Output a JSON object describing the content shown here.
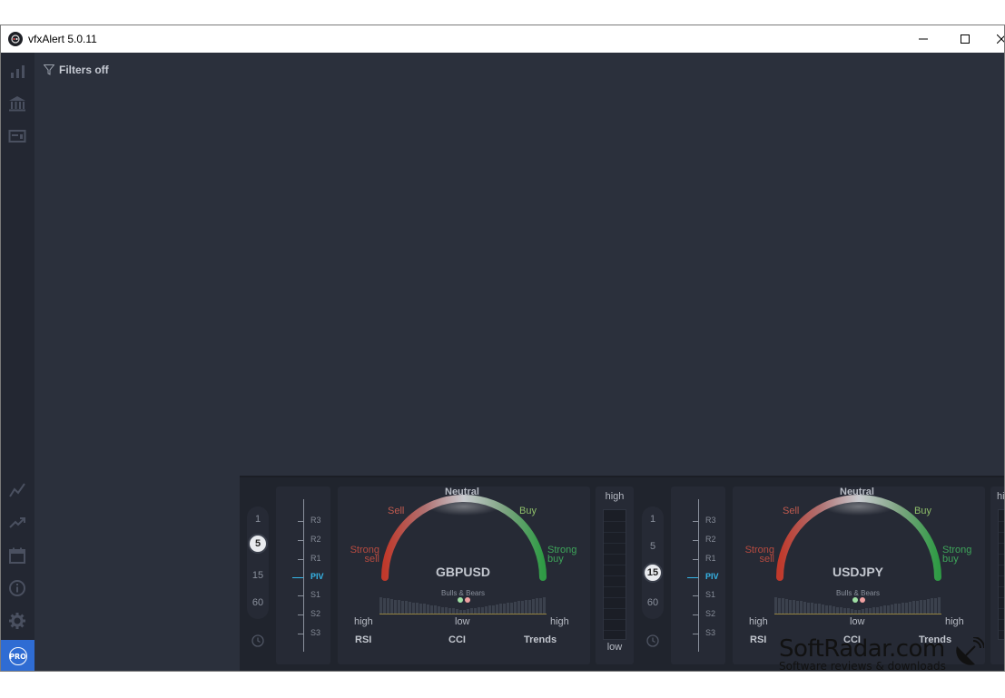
{
  "window": {
    "title": "vfxAlert 5.0.11"
  },
  "main": {
    "filter_label": "Filters off"
  },
  "sidebar": {
    "pro_label": "PRO"
  },
  "panels": [
    {
      "timeframes": [
        "1",
        "5",
        "15",
        "60"
      ],
      "active_timeframe": "5",
      "pivot_levels": [
        "R3",
        "R2",
        "R1",
        "PIV",
        "S1",
        "S2",
        "S3"
      ],
      "gauge": {
        "neutral": "Neutral",
        "sell": "Sell",
        "buy": "Buy",
        "strong_sell_1": "Strong",
        "strong_sell_2": "sell",
        "strong_buy_1": "Strong",
        "strong_buy_2": "buy",
        "pair": "GBPUSD",
        "bulls_bears": "Bulls & Bears",
        "high_left": "high",
        "low": "low",
        "high_right": "high",
        "rsi": "RSI",
        "cci": "CCI",
        "trends": "Trends"
      },
      "volume": {
        "high": "high",
        "low": "low"
      }
    },
    {
      "timeframes": [
        "1",
        "5",
        "15",
        "60"
      ],
      "active_timeframe": "15",
      "pivot_levels": [
        "R3",
        "R2",
        "R1",
        "PIV",
        "S1",
        "S2",
        "S3"
      ],
      "gauge": {
        "neutral": "Neutral",
        "sell": "Sell",
        "buy": "Buy",
        "strong_sell_1": "Strong",
        "strong_sell_2": "sell",
        "strong_buy_1": "Strong",
        "strong_buy_2": "buy",
        "pair": "USDJPY",
        "bulls_bears": "Bulls & Bears",
        "high_left": "high",
        "low": "low",
        "high_right": "high",
        "rsi": "RSI",
        "cci": "CCI",
        "trends": "Trends"
      },
      "volume": {
        "high": "high"
      }
    }
  ],
  "watermark": {
    "title": "SoftRadar.com",
    "subtitle": "Software reviews & downloads"
  },
  "colors": {
    "accent": "#2f6cd3",
    "piv": "#36b6e8",
    "sell": "#c05a4e",
    "buy": "#3ea55a"
  }
}
